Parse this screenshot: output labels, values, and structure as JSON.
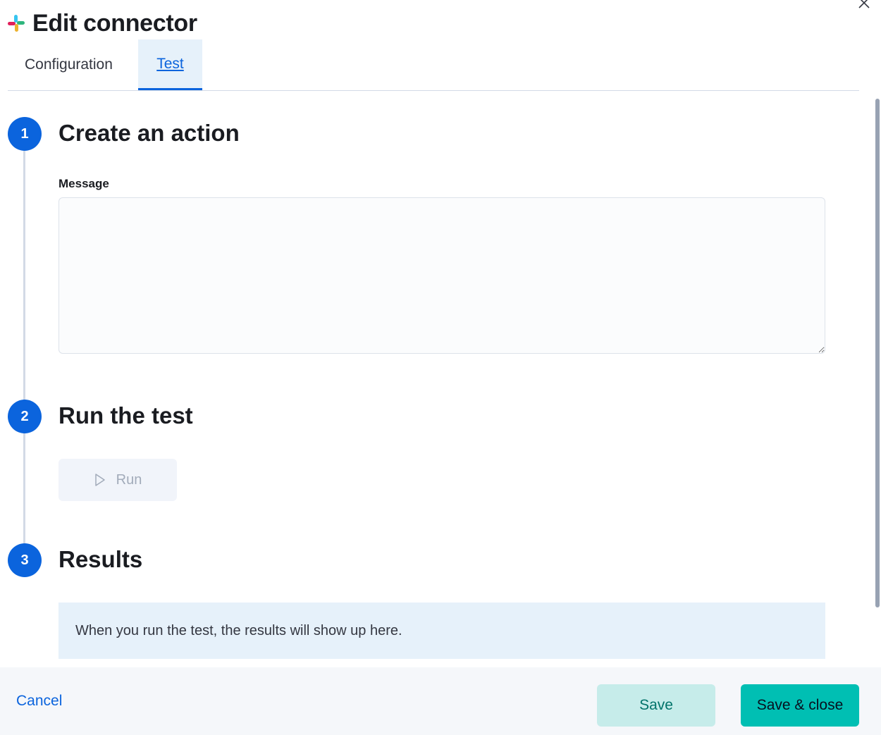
{
  "header": {
    "title": "Edit connector",
    "logo_icon": "slack-logo",
    "close_icon": "close-icon"
  },
  "tabs": [
    {
      "label": "Configuration",
      "active": false
    },
    {
      "label": "Test",
      "active": true
    }
  ],
  "steps": [
    {
      "number": "1",
      "title": "Create an action"
    },
    {
      "number": "2",
      "title": "Run the test"
    },
    {
      "number": "3",
      "title": "Results"
    }
  ],
  "form": {
    "message_label": "Message",
    "message_value": ""
  },
  "run_button": {
    "label": "Run",
    "icon": "play-icon",
    "disabled": true
  },
  "results": {
    "placeholder_text": "When you run the test, the results will show up here."
  },
  "footer": {
    "cancel_label": "Cancel",
    "save_label": "Save",
    "save_close_label": "Save & close"
  },
  "colors": {
    "primary": "#0b64dd",
    "accent": "#00bfb3",
    "accent_light": "#c6ecea",
    "results_bg": "#e6f1fa"
  }
}
